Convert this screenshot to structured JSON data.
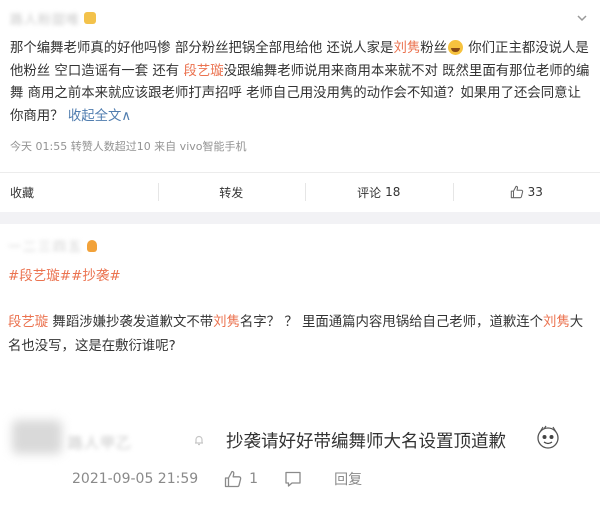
{
  "post1": {
    "author_name": "路人粉甜唯",
    "text_segments": [
      {
        "t": "那个编舞老师真的好他吗惨 部分粉丝把锅全部甩给他 还说人家是",
        "s": "normal"
      },
      {
        "t": "刘隽",
        "s": "highlight"
      },
      {
        "t": "粉丝",
        "s": "normal"
      },
      {
        "t": "",
        "s": "emoji"
      },
      {
        "t": " 你们正主都没说人是他粉丝 空口造谣有一套 还有 ",
        "s": "normal"
      },
      {
        "t": "段艺璇",
        "s": "highlight"
      },
      {
        "t": "没跟编舞老师说用来商用本来就不对 既然里面有那位老师的编舞 商用之前本来就应该跟老师打声招呼 老师自己用没用隽的动作会不知道？如果用了还会同意让你商用？ ",
        "s": "normal"
      },
      {
        "t": "收起全文",
        "s": "link"
      },
      {
        "t": "∧",
        "s": "link"
      }
    ],
    "meta": "今天 01:55 转赞人数超过10  来自 vivo智能手机",
    "actions": {
      "favorite": "收藏",
      "forward": "转发",
      "comment_label": "评论",
      "comment_count": "18",
      "like_count": "33"
    }
  },
  "post2": {
    "author_name": "一二三四五",
    "tags": [
      "#段艺璇#",
      "#抄袭#"
    ],
    "body_segments": [
      {
        "t": "段艺璇",
        "s": "highlight"
      },
      {
        "t": " 舞蹈涉嫌抄袭发道歉文不带",
        "s": "normal"
      },
      {
        "t": "刘隽",
        "s": "highlight"
      },
      {
        "t": "名字？ ？ 里面通篇内容甩锅给自己老师，道歉连个",
        "s": "normal"
      },
      {
        "t": "刘隽",
        "s": "highlight"
      },
      {
        "t": "大名也没写，这是在敷衍谁呢?",
        "s": "normal"
      }
    ]
  },
  "reply": {
    "author_name": "路人甲乙",
    "text": "抄袭请好好带编舞师大名设置顶道歉",
    "timestamp": "2021-09-05 21:59",
    "like_count": "1",
    "reply_label": "回复"
  },
  "icons": {
    "chevron": "chevron-down-icon",
    "like": "thumbs-up-icon",
    "comment": "comment-bubble-icon",
    "sticker": "sticker-face-icon",
    "emoji": "grin-emoji-icon",
    "badge": "member-badge-icon"
  },
  "colors": {
    "highlight": "#eb7350",
    "link": "#507daf",
    "meta": "#939393",
    "band": "#f2f2f5"
  }
}
